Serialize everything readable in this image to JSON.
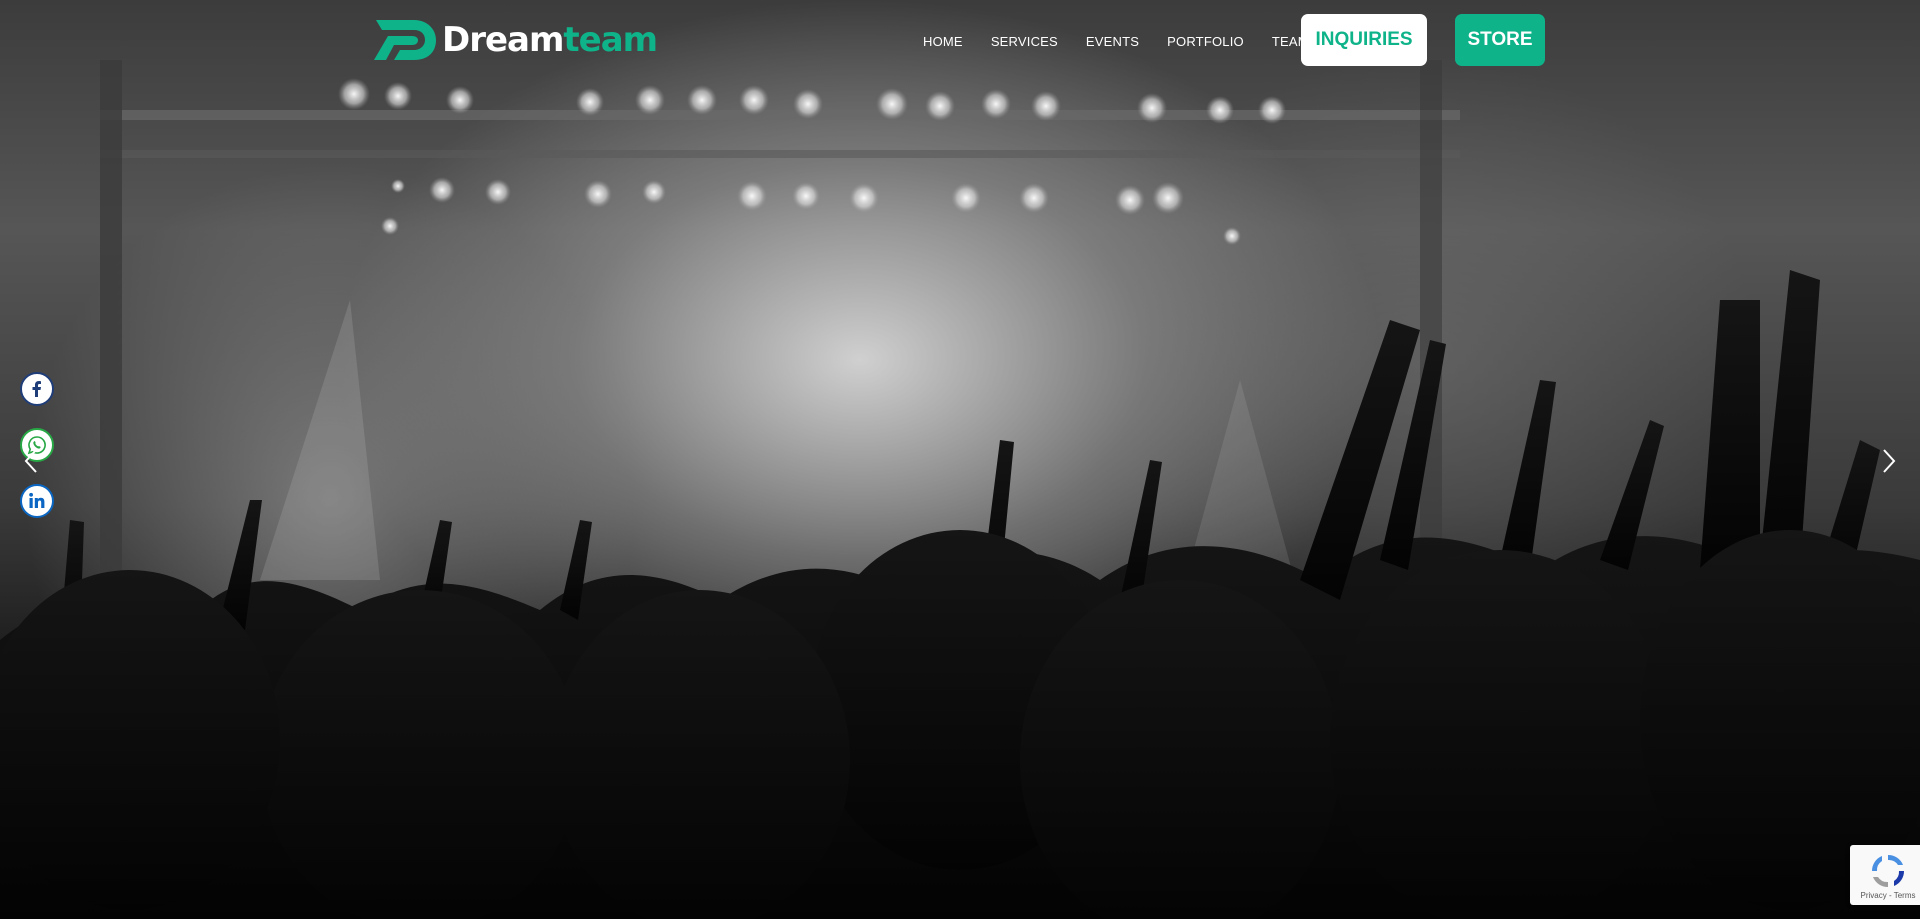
{
  "brand": {
    "name_part1": "Dream",
    "name_part2": "team",
    "accent_color": "#0fb38a",
    "logo_icon": "dreamteam-logo-icon"
  },
  "nav": {
    "items": [
      {
        "label": "HOME"
      },
      {
        "label": "SERVICES"
      },
      {
        "label": "EVENTS"
      },
      {
        "label": "PORTFOLIO"
      },
      {
        "label": "TEAM"
      }
    ]
  },
  "header_buttons": {
    "inquiries_label": "INQUIRIES",
    "store_label": "STORE"
  },
  "social": {
    "items": [
      {
        "icon": "facebook-icon",
        "color": "#1f3d78"
      },
      {
        "icon": "whatsapp-icon",
        "color": "#28a745"
      },
      {
        "icon": "linkedin-icon",
        "color": "#0a66c2"
      }
    ]
  },
  "slider": {
    "prev_icon": "chevron-left-icon",
    "next_icon": "chevron-right-icon",
    "background": "black-and-white concert crowd photo"
  },
  "recaptcha": {
    "links": "Privacy - Terms",
    "icon": "recaptcha-icon"
  }
}
